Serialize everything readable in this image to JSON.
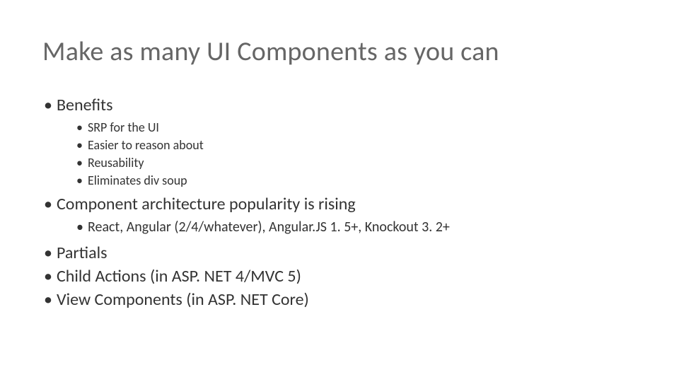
{
  "title": "Make as many UI Components as you can",
  "bullets": {
    "benefits_label": "Benefits",
    "benefits_items": {
      "0": "SRP for the UI",
      "1": "Easier to reason about",
      "2": "Reusability",
      "3": "Eliminates div soup"
    },
    "popularity_label": "Component architecture popularity is rising",
    "popularity_items": {
      "0": "React, Angular (2/4/whatever), Angular.JS 1. 5+, Knockout 3. 2+"
    },
    "partials": "Partials",
    "child_actions": "Child Actions (in ASP. NET 4/MVC 5)",
    "view_components": "View Components (in ASP. NET Core)"
  }
}
